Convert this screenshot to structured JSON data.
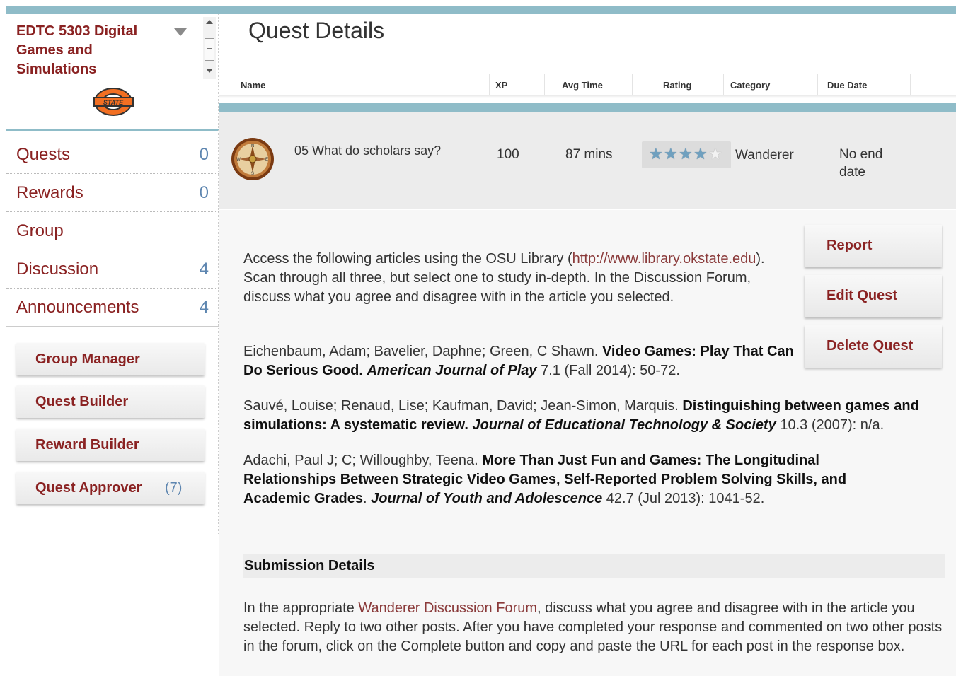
{
  "course": {
    "title": "EDTC 5303 Digital Games and Simulations",
    "logo_text": "STATE"
  },
  "nav": [
    {
      "label": "Quests",
      "count": "0"
    },
    {
      "label": "Rewards",
      "count": "0"
    },
    {
      "label": "Group",
      "count": ""
    },
    {
      "label": "Discussion",
      "count": "4"
    },
    {
      "label": "Announcements",
      "count": "4"
    }
  ],
  "tools": [
    {
      "label": "Group Manager",
      "count": ""
    },
    {
      "label": "Quest Builder",
      "count": ""
    },
    {
      "label": "Reward Builder",
      "count": ""
    },
    {
      "label": "Quest Approver",
      "count": "(7)"
    }
  ],
  "page": {
    "title": "Quest Details"
  },
  "table": {
    "headers": [
      "Name",
      "XP",
      "Avg Time",
      "Rating",
      "Category",
      "Due Date"
    ]
  },
  "quest": {
    "icon": "compass-icon",
    "name": "05 What do scholars say?",
    "xp": "100",
    "avg_time": "87 mins",
    "rating": 4,
    "rating_max": 5,
    "category": "Wanderer",
    "due_date": "No end date"
  },
  "actions": {
    "report": "Report",
    "edit": "Edit Quest",
    "delete": "Delete Quest"
  },
  "description": {
    "p1_before": "Access the following articles using the OSU Library (",
    "p1_link": "http://www.library.okstate.edu",
    "p1_after": "). Scan through all three, but select one to study in-depth. In the Discussion Forum, discuss what you agree and disagree with in the article you selected."
  },
  "references": [
    {
      "authors": "Eichenbaum, Adam; Bavelier, Daphne; Green, C Shawn. ",
      "title": "Video Games: Play That Can Do Serious Good.",
      "journal": "American Journal of Play",
      "details": "7.1 (Fall 2014): 50-72."
    },
    {
      "authors": "Sauvé, Louise; Renaud, Lise; Kaufman, David; Jean-Simon, Marquis. ",
      "title": "Distinguishing between games and simulations: A systematic review.",
      "journal": "Journal of Educational Technology & Society",
      "details": "10.3 (2007): n/a."
    },
    {
      "authors": "Adachi, Paul J; C; Willoughby, Teena. ",
      "title": "More Than Just Fun and Games: The Longitudinal Relationships Between Strategic Video Games, Self-Reported Problem Solving Skills, and Academic Grades",
      "journal": "Journal of Youth and Adolescence",
      "details": "42.7 (Jul 2013): 1041-52."
    }
  ],
  "submission": {
    "heading": "Submission Details",
    "before": "In the appropriate ",
    "link": "Wanderer Discussion Forum",
    "after": ", discuss what you agree and disagree with in the article you selected.  Reply to two other posts.  After you have completed your response and commented on two other posts in the forum, click on the Complete button and copy and paste the URL for each post in the response box."
  },
  "colors": {
    "accent": "#8a2222",
    "teal": "#8fbcc8",
    "count_blue": "#5e86b0",
    "star": "#6fa0bf"
  }
}
